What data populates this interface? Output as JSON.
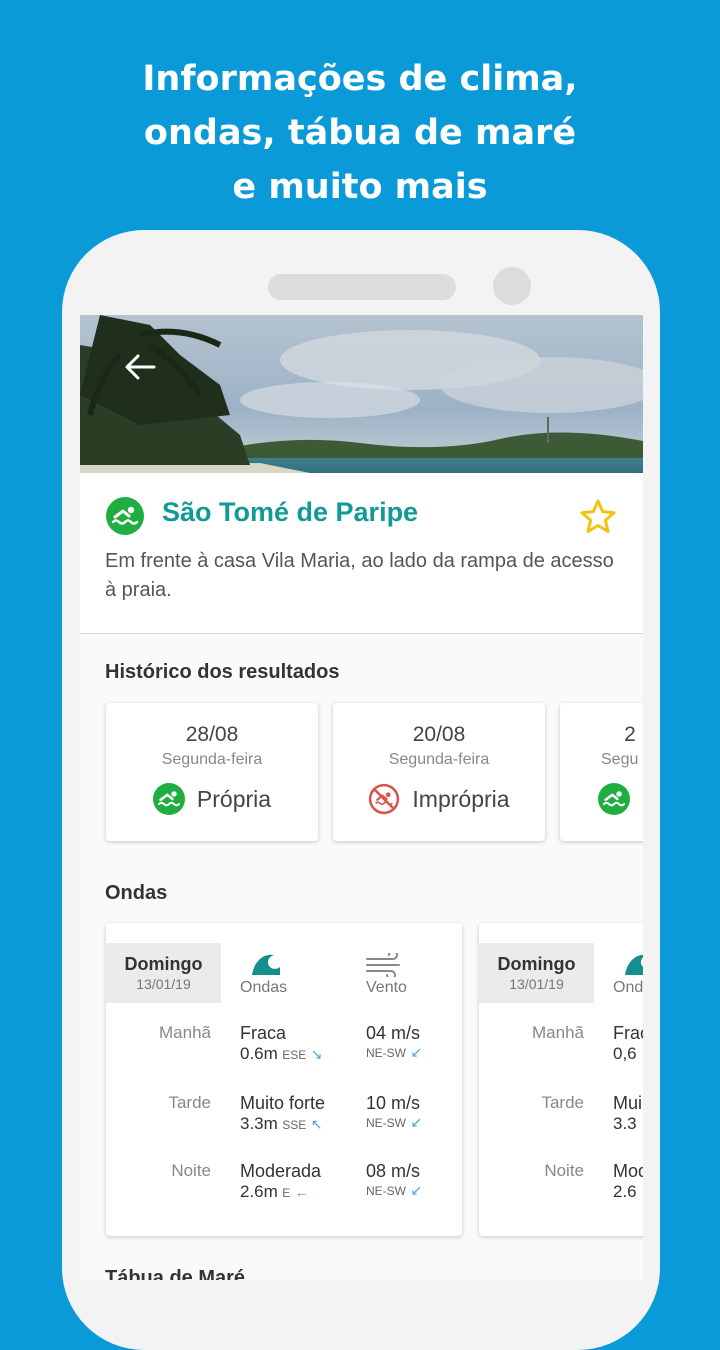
{
  "headline": {
    "line1": "Informações de clima,",
    "line2": "ondas, tábua de maré",
    "line3": "e muito mais"
  },
  "beach": {
    "name": "São Tomé de Paripe",
    "description": "Em frente à casa Vila Maria, ao lado da rampa de acesso à praia.",
    "favorite_icon": "star-outline-icon",
    "back_icon": "arrow-left-icon"
  },
  "history": {
    "title": "Histórico dos resultados",
    "items": [
      {
        "date": "28/08",
        "day": "Segunda-feira",
        "status": "Própria",
        "status_icon": "swimmer-ok-icon"
      },
      {
        "date": "20/08",
        "day": "Segunda-feira",
        "status": "Imprópria",
        "status_icon": "swimmer-prohibited-icon"
      },
      {
        "date": "2",
        "day": "Segu",
        "status": "",
        "status_icon": "swimmer-ok-icon"
      }
    ]
  },
  "waves": {
    "title": "Ondas",
    "cards": [
      {
        "day": "Domingo",
        "date": "13/01/19",
        "col_waves": "Ondas",
        "col_wind": "Vento",
        "rows": [
          {
            "period": "Manhã",
            "strength": "Fraca",
            "height": "0.6m",
            "wave_dir": "ESE",
            "wave_arrow": "↘",
            "wind_speed": "04 m/s",
            "wind_dir": "NE-SW",
            "wind_arrow": "↙"
          },
          {
            "period": "Tarde",
            "strength": "Muito forte",
            "height": "3.3m",
            "wave_dir": "SSE",
            "wave_arrow": "↖",
            "wind_speed": "10 m/s",
            "wind_dir": "NE-SW",
            "wind_arrow": "↙"
          },
          {
            "period": "Noite",
            "strength": "Moderada",
            "height": "2.6m",
            "wave_dir": "E",
            "wave_arrow": "←",
            "wind_speed": "08 m/s",
            "wind_dir": "NE-SW",
            "wind_arrow": "↙"
          }
        ]
      },
      {
        "day": "Domingo",
        "date": "13/01/19",
        "col_waves": "Ond",
        "rows": [
          {
            "period": "Manhã",
            "strength": "Frac",
            "height": "0,6"
          },
          {
            "period": "Tarde",
            "strength": "Mui",
            "height": "3.3"
          },
          {
            "period": "Noite",
            "strength": "Mod",
            "height": "2.6"
          }
        ]
      }
    ]
  },
  "footer_peek": "Tábua de Maré",
  "colors": {
    "background": "#0b9ad8",
    "accent_title": "#129a96",
    "ok_green": "#1fae3f",
    "bad_red": "#d9534f",
    "star": "#f2c40f"
  }
}
